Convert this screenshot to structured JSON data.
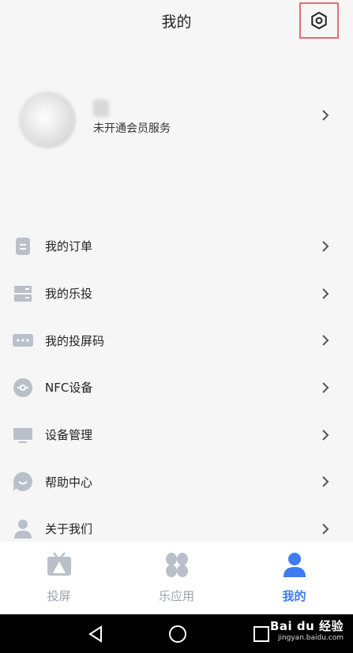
{
  "header": {
    "title": "我的"
  },
  "profile": {
    "vip_text": "未开通会员服务"
  },
  "menu": [
    {
      "label": "我的订单",
      "icon": "order-icon"
    },
    {
      "label": "我的乐投",
      "icon": "device-stack-icon"
    },
    {
      "label": "我的投屏码",
      "icon": "code-icon"
    },
    {
      "label": "NFC设备",
      "icon": "nfc-icon"
    },
    {
      "label": "设备管理",
      "icon": "monitor-icon"
    },
    {
      "label": "帮助中心",
      "icon": "help-icon"
    },
    {
      "label": "关于我们",
      "icon": "person-icon"
    }
  ],
  "tabs": [
    {
      "label": "投屏",
      "icon": "tv-icon"
    },
    {
      "label": "乐应用",
      "icon": "apps-icon"
    },
    {
      "label": "我的",
      "icon": "user-icon",
      "active": true
    }
  ],
  "watermark": {
    "top": "Bai du 经验",
    "bottom": "jingyan.baidu.com"
  },
  "colors": {
    "accent": "#3d7bf0",
    "icon_gray": "#b9c0ca",
    "highlight_box": "#e26b75"
  }
}
